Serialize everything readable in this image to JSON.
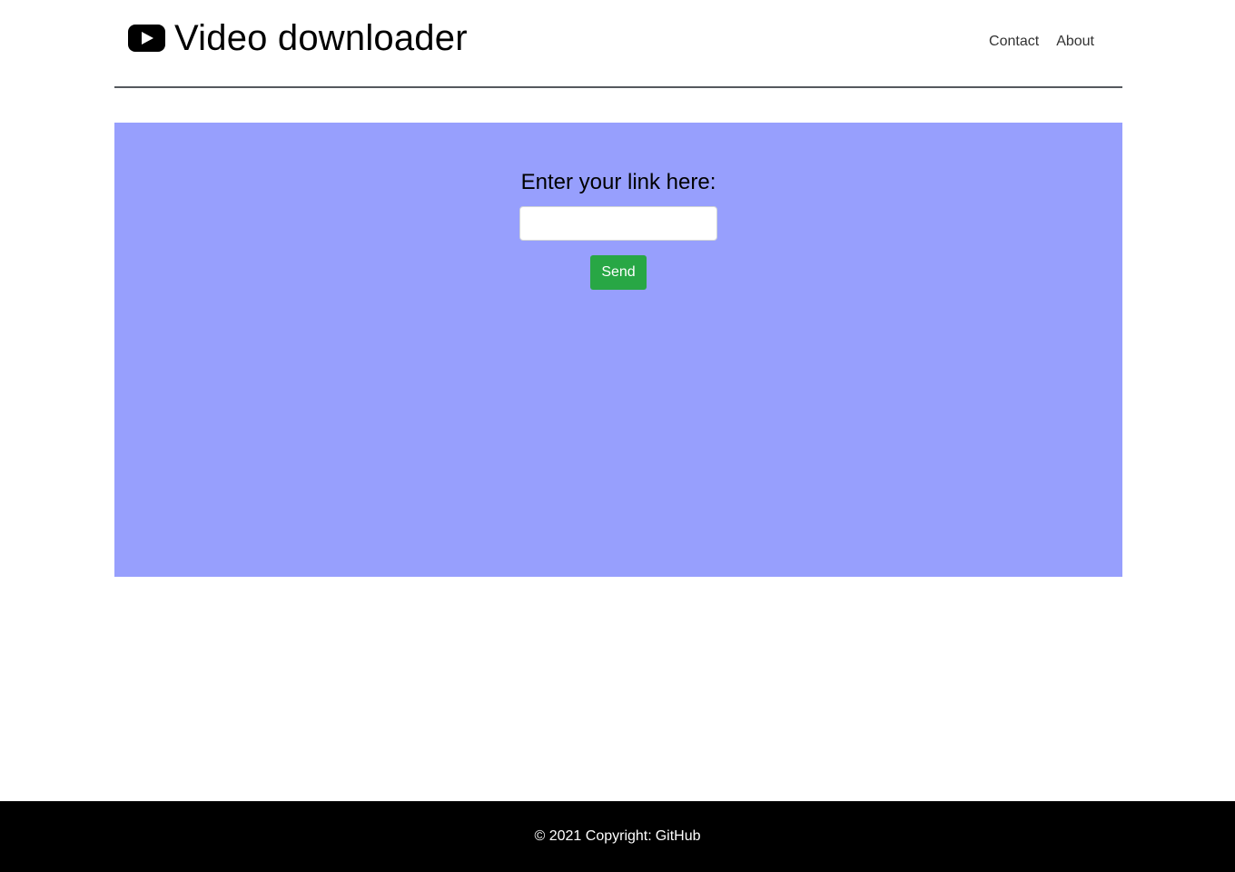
{
  "header": {
    "title": "Video downloader",
    "logo_icon": "youtube-play-icon",
    "nav": [
      {
        "label": "Contact"
      },
      {
        "label": "About"
      }
    ]
  },
  "form": {
    "label": "Enter your link here:",
    "input_value": "",
    "input_placeholder": "",
    "send_label": "Send"
  },
  "footer": {
    "copyright": "© 2021 Copyright:",
    "link_label": "GitHub"
  },
  "colors": {
    "panel": "#979ffd",
    "send_button": "#28a745",
    "footer": "#000000"
  }
}
